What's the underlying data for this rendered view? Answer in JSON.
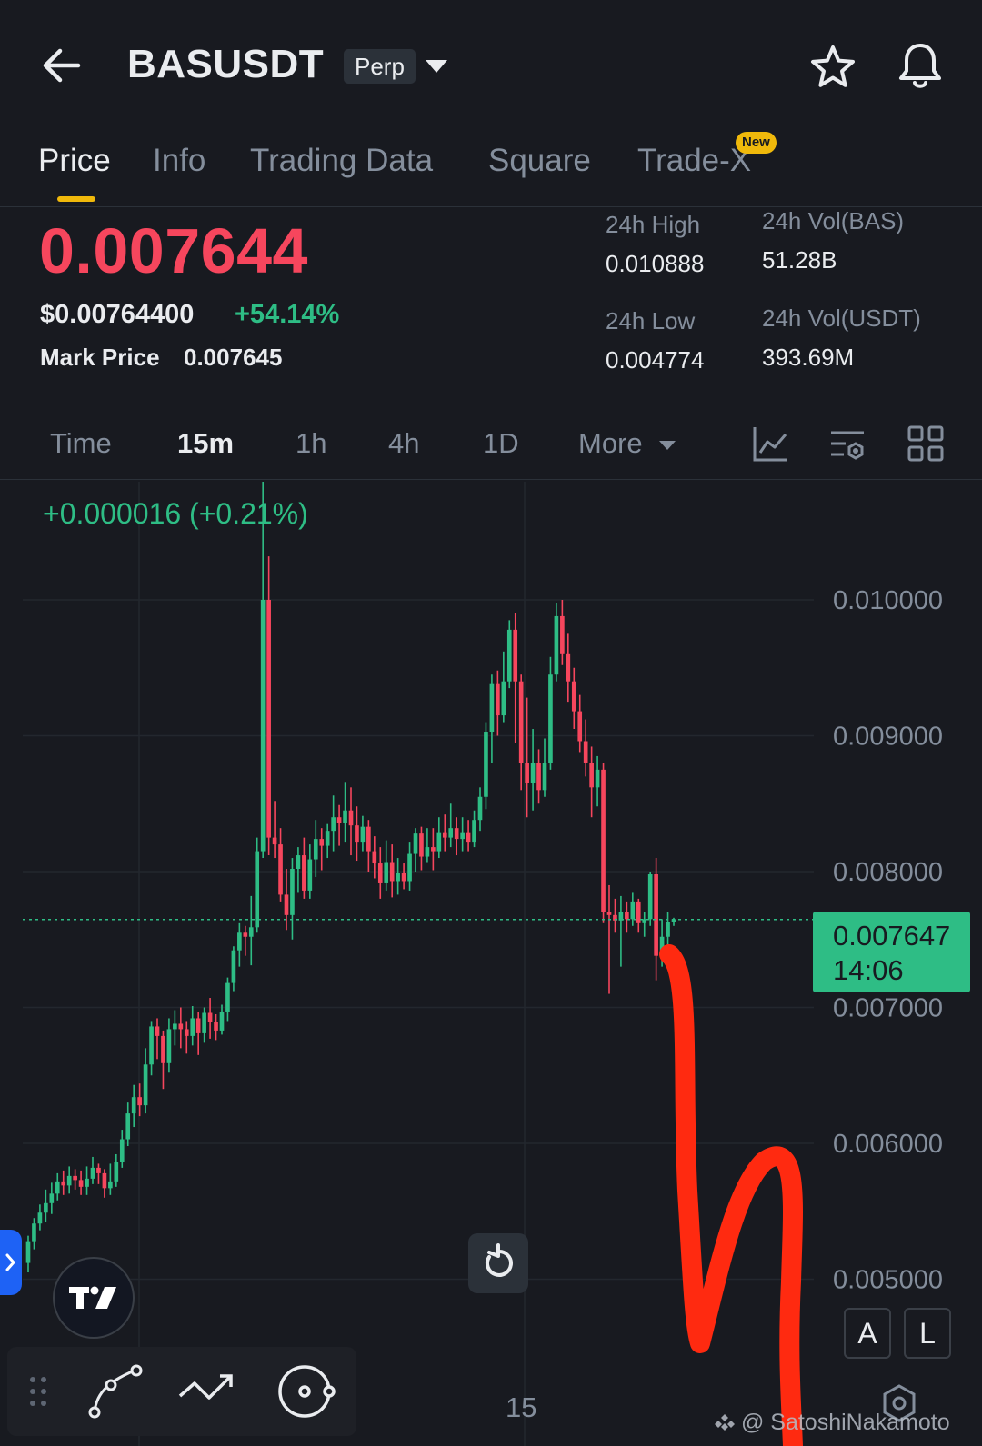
{
  "header": {
    "symbol": "BASUSDT",
    "contract_type": "Perp"
  },
  "tabs": [
    {
      "label": "Price",
      "active": true
    },
    {
      "label": "Info",
      "active": false
    },
    {
      "label": "Trading Data",
      "active": false
    },
    {
      "label": "Square",
      "active": false
    },
    {
      "label": "Trade-X",
      "active": false,
      "badge": "New"
    }
  ],
  "ticker": {
    "last_price": "0.007644",
    "usd_price": "$0.00764400",
    "change_pct": "+54.14%",
    "mark_price_label": "Mark Price",
    "mark_price": "0.007645"
  },
  "stats": {
    "high_label": "24h High",
    "high_value": "0.010888",
    "low_label": "24h Low",
    "low_value": "0.004774",
    "vol_base_label": "24h Vol(BAS)",
    "vol_base_value": "51.28B",
    "vol_quote_label": "24h Vol(USDT)",
    "vol_quote_value": "393.69M"
  },
  "intervals": [
    {
      "label": "Time",
      "active": false
    },
    {
      "label": "15m",
      "active": true
    },
    {
      "label": "1h",
      "active": false
    },
    {
      "label": "4h",
      "active": false
    },
    {
      "label": "1D",
      "active": false
    },
    {
      "label": "More",
      "active": false
    }
  ],
  "chart": {
    "change_text": "+0.000016 (+0.21%)",
    "current_price": "0.007647",
    "countdown": "14:06",
    "time_tick": "15",
    "colors": {
      "up": "#2ebd85",
      "down": "#f6465d",
      "annotation": "#ff2a10"
    }
  },
  "buttons": {
    "auto_scale": "A",
    "log_scale": "L"
  },
  "watermark": "@ SatoshiNakamoto",
  "chart_data": {
    "type": "candlestick",
    "interval": "15m",
    "yticks": [
      "0.010000",
      "0.009000",
      "0.008000",
      "0.007000",
      "0.006000",
      "0.005000"
    ],
    "xticks": [
      "15"
    ],
    "current_price_line": 0.007647,
    "candles": [
      [
        0.00512,
        0.00528,
        0.00505,
        0.00532
      ],
      [
        0.00528,
        0.00541,
        0.00522,
        0.00545
      ],
      [
        0.00541,
        0.00549,
        0.00536,
        0.00555
      ],
      [
        0.00549,
        0.00556,
        0.00542,
        0.00566
      ],
      [
        0.00556,
        0.00563,
        0.00548,
        0.00571
      ],
      [
        0.00563,
        0.00572,
        0.00558,
        0.00578
      ],
      [
        0.00572,
        0.00569,
        0.00562,
        0.0058
      ],
      [
        0.00569,
        0.00576,
        0.00563,
        0.00583
      ],
      [
        0.00576,
        0.00573,
        0.00566,
        0.00581
      ],
      [
        0.00573,
        0.00568,
        0.00562,
        0.0058
      ],
      [
        0.00568,
        0.00574,
        0.00562,
        0.00583
      ],
      [
        0.00574,
        0.00582,
        0.0057,
        0.0059
      ],
      [
        0.00582,
        0.00578,
        0.0057,
        0.00585
      ],
      [
        0.00578,
        0.00567,
        0.0056,
        0.00581
      ],
      [
        0.00567,
        0.00572,
        0.00562,
        0.00585
      ],
      [
        0.00572,
        0.00586,
        0.00568,
        0.00592
      ],
      [
        0.00586,
        0.00603,
        0.00582,
        0.0061
      ],
      [
        0.00603,
        0.00622,
        0.00598,
        0.0063
      ],
      [
        0.00622,
        0.00634,
        0.00612,
        0.00643
      ],
      [
        0.00634,
        0.00628,
        0.0062,
        0.00644
      ],
      [
        0.00628,
        0.00658,
        0.00622,
        0.0067
      ],
      [
        0.00658,
        0.00686,
        0.0065,
        0.0069
      ],
      [
        0.00686,
        0.00679,
        0.00662,
        0.00692
      ],
      [
        0.00679,
        0.00659,
        0.0064,
        0.00683
      ],
      [
        0.00659,
        0.00684,
        0.00652,
        0.00692
      ],
      [
        0.00684,
        0.00688,
        0.00672,
        0.00698
      ],
      [
        0.00688,
        0.00684,
        0.0067,
        0.007
      ],
      [
        0.00684,
        0.00679,
        0.00666,
        0.0069
      ],
      [
        0.00679,
        0.00692,
        0.00672,
        0.00701
      ],
      [
        0.00692,
        0.00681,
        0.00665,
        0.00697
      ],
      [
        0.00681,
        0.00696,
        0.00674,
        0.007
      ],
      [
        0.00696,
        0.00689,
        0.00677,
        0.00707
      ],
      [
        0.00689,
        0.00683,
        0.00676,
        0.00695
      ],
      [
        0.00683,
        0.00697,
        0.0068,
        0.00702
      ],
      [
        0.00697,
        0.00718,
        0.0069,
        0.00722
      ],
      [
        0.00718,
        0.00742,
        0.00712,
        0.00745
      ],
      [
        0.00742,
        0.00755,
        0.0073,
        0.00762
      ],
      [
        0.00755,
        0.00752,
        0.00738,
        0.0076
      ],
      [
        0.00752,
        0.00759,
        0.00731,
        0.00782
      ],
      [
        0.00759,
        0.00815,
        0.00755,
        0.00825
      ],
      [
        0.00815,
        0.01,
        0.0081,
        0.01088
      ],
      [
        0.01,
        0.00825,
        0.00812,
        0.01032
      ],
      [
        0.00825,
        0.0082,
        0.0081,
        0.00852
      ],
      [
        0.0082,
        0.00783,
        0.00778,
        0.00832
      ],
      [
        0.00783,
        0.00768,
        0.00757,
        0.00802
      ],
      [
        0.00768,
        0.00802,
        0.0075,
        0.0081
      ],
      [
        0.00802,
        0.00812,
        0.00785,
        0.00818
      ],
      [
        0.00812,
        0.00786,
        0.0078,
        0.00825
      ],
      [
        0.00786,
        0.00809,
        0.0078,
        0.0082
      ],
      [
        0.00809,
        0.00824,
        0.00796,
        0.00838
      ],
      [
        0.00824,
        0.00819,
        0.00801,
        0.00832
      ],
      [
        0.00819,
        0.0083,
        0.0081,
        0.00835
      ],
      [
        0.0083,
        0.0084,
        0.00815,
        0.00856
      ],
      [
        0.0084,
        0.00836,
        0.00819,
        0.00849
      ],
      [
        0.00836,
        0.00845,
        0.00822,
        0.00866
      ],
      [
        0.00845,
        0.00834,
        0.00812,
        0.00862
      ],
      [
        0.00834,
        0.00822,
        0.00808,
        0.00848
      ],
      [
        0.00822,
        0.00833,
        0.00815,
        0.00841
      ],
      [
        0.00833,
        0.00815,
        0.008,
        0.00838
      ],
      [
        0.00815,
        0.00806,
        0.00795,
        0.00826
      ],
      [
        0.00806,
        0.00792,
        0.0078,
        0.00818
      ],
      [
        0.00792,
        0.00807,
        0.00786,
        0.00823
      ],
      [
        0.00807,
        0.00793,
        0.00781,
        0.0082
      ],
      [
        0.00793,
        0.00799,
        0.00783,
        0.0081
      ],
      [
        0.00799,
        0.00793,
        0.00787,
        0.00806
      ],
      [
        0.00793,
        0.00813,
        0.00786,
        0.00822
      ],
      [
        0.00813,
        0.00828,
        0.008,
        0.00832
      ],
      [
        0.00828,
        0.00811,
        0.00801,
        0.00833
      ],
      [
        0.00811,
        0.00818,
        0.00807,
        0.00832
      ],
      [
        0.00818,
        0.00815,
        0.00801,
        0.00832
      ],
      [
        0.00815,
        0.00829,
        0.0081,
        0.0084
      ],
      [
        0.00829,
        0.00825,
        0.00815,
        0.00842
      ],
      [
        0.00825,
        0.00832,
        0.00818,
        0.0085
      ],
      [
        0.00832,
        0.00824,
        0.00812,
        0.0084
      ],
      [
        0.00824,
        0.00829,
        0.00815,
        0.0084
      ],
      [
        0.00829,
        0.00822,
        0.00815,
        0.00838
      ],
      [
        0.00822,
        0.00838,
        0.00818,
        0.00845
      ],
      [
        0.00838,
        0.00855,
        0.0083,
        0.00862
      ],
      [
        0.00855,
        0.00903,
        0.00846,
        0.0091
      ],
      [
        0.00903,
        0.00938,
        0.0088,
        0.00945
      ],
      [
        0.00938,
        0.00915,
        0.009,
        0.00948
      ],
      [
        0.00915,
        0.0094,
        0.0091,
        0.00962
      ],
      [
        0.0094,
        0.00978,
        0.00935,
        0.00985
      ],
      [
        0.00978,
        0.0094,
        0.00895,
        0.0099
      ],
      [
        0.0094,
        0.0088,
        0.0086,
        0.00945
      ],
      [
        0.0088,
        0.00865,
        0.0084,
        0.00928
      ],
      [
        0.00865,
        0.0088,
        0.00845,
        0.00905
      ],
      [
        0.0088,
        0.0086,
        0.0085,
        0.0089
      ],
      [
        0.0086,
        0.0088,
        0.00855,
        0.00898
      ],
      [
        0.0088,
        0.00945,
        0.00875,
        0.00958
      ],
      [
        0.00945,
        0.00988,
        0.0094,
        0.00998
      ],
      [
        0.00988,
        0.0096,
        0.00952,
        0.01
      ],
      [
        0.0096,
        0.0094,
        0.00925,
        0.00975
      ],
      [
        0.0094,
        0.00918,
        0.00905,
        0.0095
      ],
      [
        0.00918,
        0.00896,
        0.00888,
        0.0093
      ],
      [
        0.00896,
        0.0088,
        0.0087,
        0.00912
      ],
      [
        0.0088,
        0.00862,
        0.0084,
        0.00892
      ],
      [
        0.00862,
        0.00875,
        0.00848,
        0.00885
      ],
      [
        0.00875,
        0.0077,
        0.00762,
        0.0088
      ],
      [
        0.0077,
        0.00768,
        0.0071,
        0.0079
      ],
      [
        0.00768,
        0.00764,
        0.00755,
        0.0078
      ],
      [
        0.00764,
        0.0077,
        0.0073,
        0.00782
      ],
      [
        0.0077,
        0.00765,
        0.00755,
        0.00778
      ],
      [
        0.00765,
        0.00778,
        0.0076,
        0.00785
      ],
      [
        0.00778,
        0.00762,
        0.00755,
        0.0078
      ],
      [
        0.00762,
        0.00765,
        0.00752,
        0.0077
      ],
      [
        0.00765,
        0.00798,
        0.0076,
        0.008
      ],
      [
        0.00798,
        0.00738,
        0.0072,
        0.0081
      ],
      [
        0.00738,
        0.00752,
        0.0073,
        0.00765
      ],
      [
        0.00752,
        0.00763,
        0.00745,
        0.0077
      ],
      [
        0.00763,
        0.00765,
        0.0076,
        0.00766
      ]
    ]
  }
}
